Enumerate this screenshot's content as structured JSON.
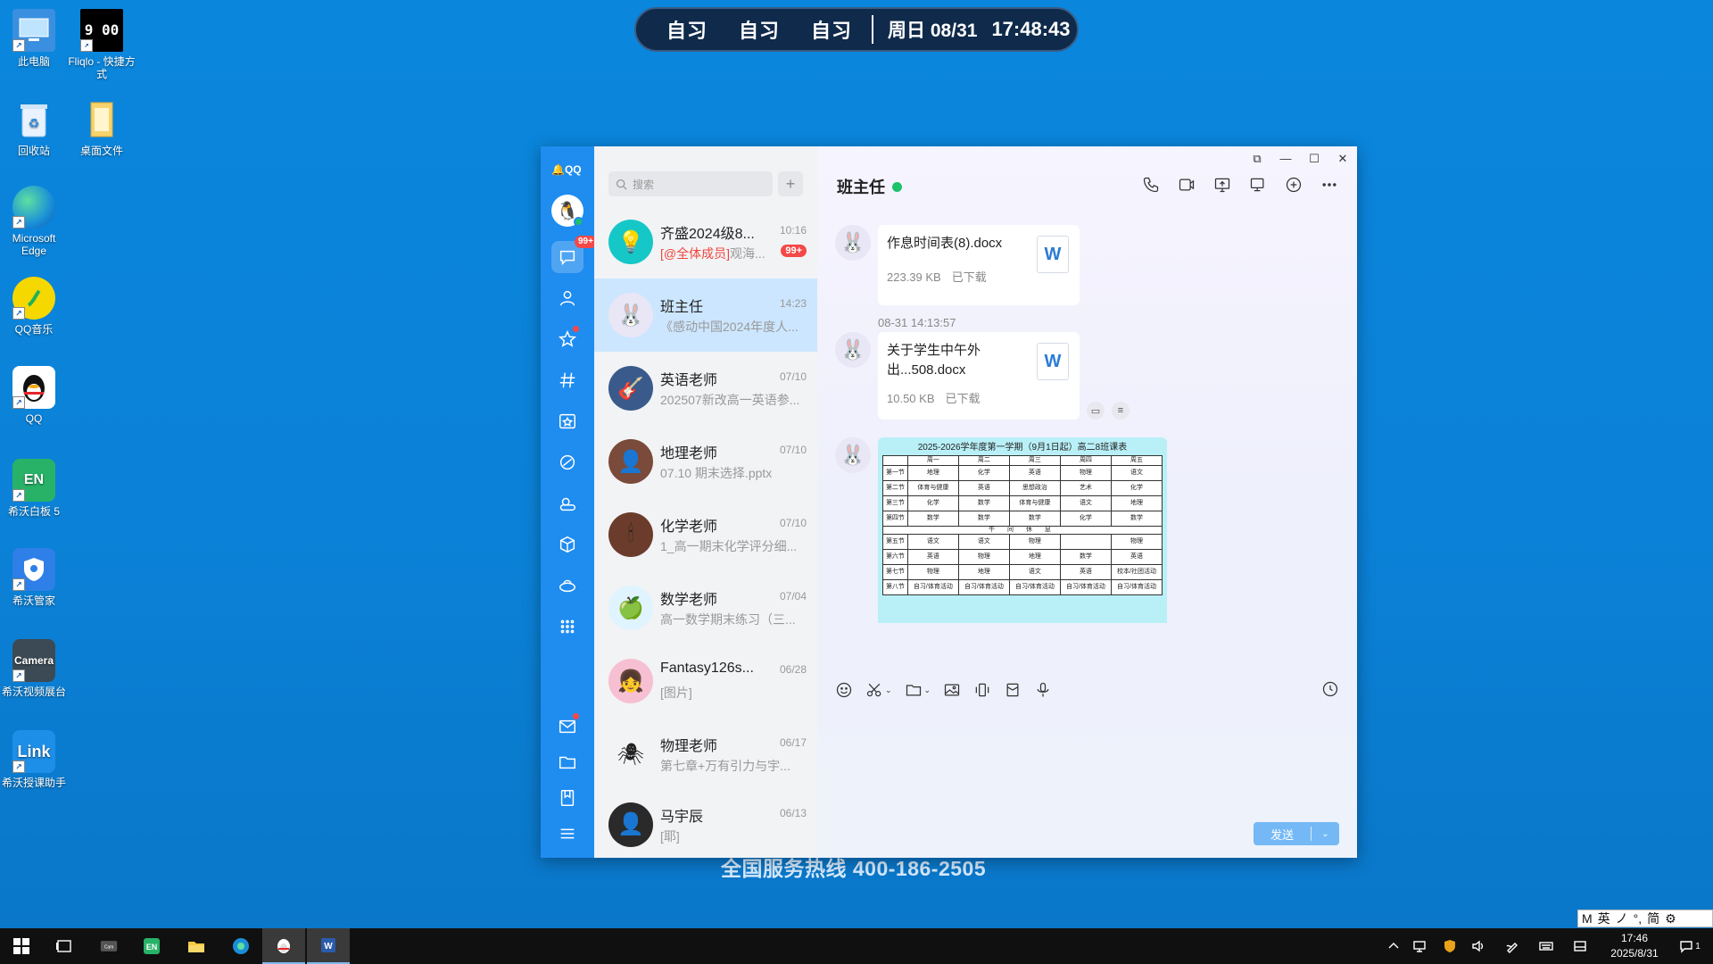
{
  "desktop": {
    "icons": [
      {
        "label": "此电脑"
      },
      {
        "label": "Fliqlo - 快捷方式",
        "glyph": "9 00"
      },
      {
        "label": "回收站"
      },
      {
        "label": "桌面文件"
      },
      {
        "label": "Microsoft Edge"
      },
      {
        "label": "QQ音乐"
      },
      {
        "label": "QQ"
      },
      {
        "label": "希沃白板 5",
        "glyph": "EN"
      },
      {
        "label": "希沃管家"
      },
      {
        "label": "希沃视频展台",
        "glyph": "Camera"
      },
      {
        "label": "希沃授课助手",
        "glyph": "Link"
      }
    ],
    "hotline": "全国服务热线 400-186-2505"
  },
  "topbar": {
    "subjects": [
      "自习",
      "自习",
      "自习"
    ],
    "date": "周日 08/31",
    "time": "17:48:43"
  },
  "qq": {
    "logo": "QQ",
    "rail_badge": "99+",
    "search_placeholder": "搜索",
    "add_label": "+",
    "conversations": [
      {
        "name": "齐盛2024级8...",
        "time": "10:16",
        "mention": "[@全体成员]",
        "msg": "观海...",
        "badge": "99+"
      },
      {
        "name": "班主任",
        "time": "14:23",
        "msg": "《感动中国2024年度人..."
      },
      {
        "name": "英语老师",
        "time": "07/10",
        "msg": "202507新改高一英语参..."
      },
      {
        "name": "地理老师",
        "time": "07/10",
        "msg": "07.10 期末选择.pptx"
      },
      {
        "name": "化学老师",
        "time": "07/10",
        "msg": "1_高一期末化学评分细..."
      },
      {
        "name": "数学老师",
        "time": "07/04",
        "msg": "高一数学期末练习（三..."
      },
      {
        "name": "Fantasy126s...",
        "time": "06/28",
        "msg": "[图片]"
      },
      {
        "name": "物理老师",
        "time": "06/17",
        "msg": "第七章+万有引力与宇..."
      },
      {
        "name": "马宇辰",
        "time": "06/13",
        "msg": "[耶]"
      }
    ],
    "chat": {
      "title": "班主任",
      "files": [
        {
          "name": "作息时间表(8).docx",
          "size": "223.39 KB",
          "status": "已下载",
          "icon": "W"
        },
        {
          "name": "关于学生中午外出...508.docx",
          "size": "10.50 KB",
          "status": "已下载",
          "icon": "W"
        }
      ],
      "timestamp": "08-31 14:13:57",
      "schedule": {
        "title": "2025-2026学年度第一学期（9月1日起）高二8班课表",
        "headers": [
          "",
          "周一",
          "周二",
          "周三",
          "周四",
          "周五"
        ],
        "rows": [
          [
            "第一节",
            "地理",
            "化学",
            "英语",
            "物理",
            "语文"
          ],
          [
            "第二节",
            "体育与健康",
            "英语",
            "思想政治",
            "艺术",
            "化学"
          ],
          [
            "第三节",
            "化学",
            "数学",
            "体育与健康",
            "语文",
            "地理"
          ],
          [
            "第四节",
            "数学",
            "数学",
            "数学",
            "化学",
            "数学"
          ],
          [
            "第五节",
            "语文",
            "语文",
            "物理",
            "",
            "物理"
          ],
          [
            "第六节",
            "英语",
            "物理",
            "地理",
            "数学",
            "英语"
          ],
          [
            "第七节",
            "物理",
            "地理",
            "语文",
            "英语",
            "校本/社团活动"
          ],
          [
            "第八节",
            "自习/体育活动",
            "自习/体育活动",
            "自习/体育活动",
            "自习/体育活动",
            "自习/体育活动"
          ]
        ],
        "noon": "午 间 休 息"
      },
      "send_label": "发送"
    }
  },
  "ime": {
    "items": [
      "M",
      "英",
      "ノ",
      "°,",
      "简",
      "⚙"
    ]
  },
  "taskbar": {
    "clock_time": "17:46",
    "clock_date": "2025/8/31",
    "notification_count": "1"
  }
}
